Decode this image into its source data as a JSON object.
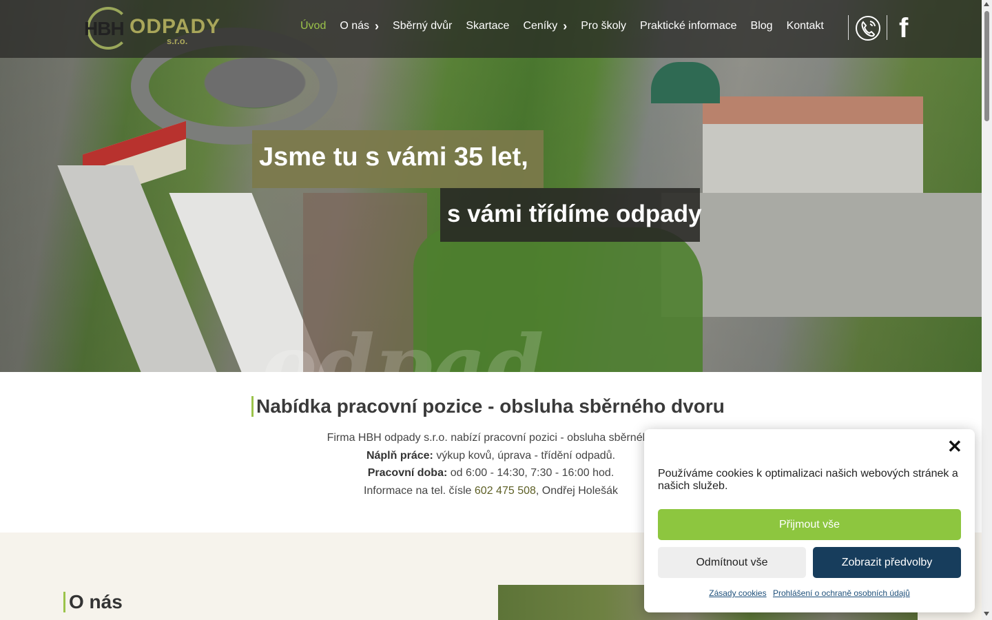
{
  "header": {
    "logo": {
      "hbh": "HBH",
      "odpady": "ODPADY",
      "sro": "s.r.o."
    },
    "nav": [
      {
        "label": "Úvod",
        "active": true,
        "has_dropdown": false
      },
      {
        "label": "O nás",
        "active": false,
        "has_dropdown": true
      },
      {
        "label": "Sběrný dvůr",
        "active": false,
        "has_dropdown": false
      },
      {
        "label": "Skartace",
        "active": false,
        "has_dropdown": false
      },
      {
        "label": "Ceníky",
        "active": false,
        "has_dropdown": true
      },
      {
        "label": "Pro školy",
        "active": false,
        "has_dropdown": false
      },
      {
        "label": "Praktické informace",
        "active": false,
        "has_dropdown": false
      },
      {
        "label": "Blog",
        "active": false,
        "has_dropdown": false
      },
      {
        "label": "Kontakt",
        "active": false,
        "has_dropdown": false
      }
    ],
    "icons": [
      "phone-icon",
      "facebook-icon"
    ]
  },
  "hero": {
    "title_line1": "Jsme tu s vámi 35 let,",
    "title_line2": "s vámi třídíme odpady"
  },
  "job": {
    "heading": "Nabídka pracovní pozice - obsluha sběrného dvoru",
    "intro": "Firma HBH odpady s.r.o. nabízí pracovní pozici - obsluha sběrného",
    "duty_label": "Náplň práce:",
    "duty_text": " výkup kovů, úprava - třídění odpadů.",
    "hours_label": "Pracovní doba:",
    "hours_text": " od 6:00 - 14:30, 7:30 - 16:00 hod.",
    "contact_prefix": "Informace na tel. čísle ",
    "phone": "602 475 508",
    "contact_suffix": ", Ondřej Holešák"
  },
  "about": {
    "heading": "O nás"
  },
  "cookie": {
    "message": "Používáme cookies k optimalizaci našich webových stránek a našich služeb.",
    "accept_label": "Přijmout vše",
    "deny_label": "Odmítnout vše",
    "prefs_label": "Zobrazit předvolby",
    "link_cookies": "Zásady cookies",
    "link_privacy": "Prohlášení o ochraně osobních údajů"
  },
  "colors": {
    "accent_green": "#9bc34a",
    "olive": "#7c7a4b",
    "accept_button": "#8dc63f",
    "prefs_button": "#173d5c"
  }
}
